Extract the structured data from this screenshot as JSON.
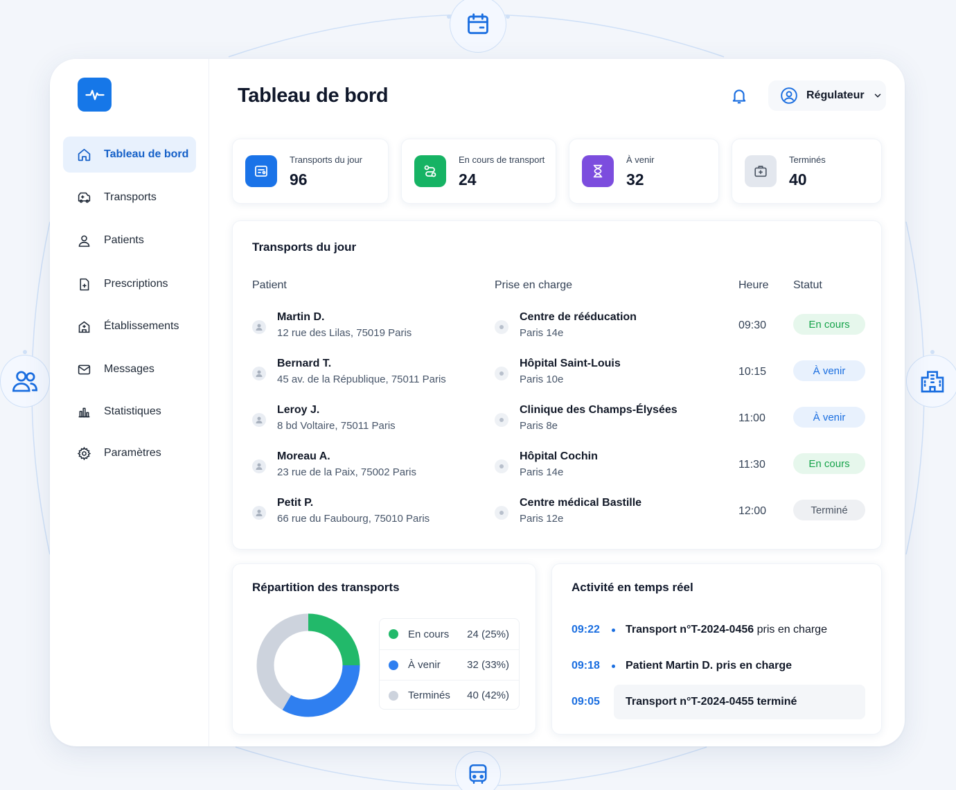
{
  "app": {
    "title": "Tableau de bord"
  },
  "sidebar": {
    "items": [
      {
        "label": "Tableau de bord",
        "icon": "home-icon",
        "active": true
      },
      {
        "label": "Transports",
        "icon": "ambulance-icon"
      },
      {
        "label": "Patients",
        "icon": "user-icon"
      },
      {
        "label": "Prescriptions",
        "icon": "document-icon"
      },
      {
        "label": "Établissements",
        "icon": "hospital-icon"
      },
      {
        "label": "Messages",
        "icon": "mail-icon"
      },
      {
        "label": "Statistiques",
        "icon": "chart-icon"
      },
      {
        "label": "Paramètres",
        "icon": "gear-icon"
      }
    ]
  },
  "header": {
    "title": "Tableau de bord",
    "user": "Régulateur"
  },
  "stats": [
    {
      "label": "Transports du jour",
      "value": "96",
      "color": "#1a73e8"
    },
    {
      "label": "En cours de transport",
      "value": "24",
      "color": "#16b364"
    },
    {
      "label": "À venir",
      "value": "32",
      "color": "#7c4dde"
    },
    {
      "label": "Terminés",
      "value": "40",
      "color": "#e3e7ee"
    }
  ],
  "transports": {
    "title": "Transports du jour",
    "columns": [
      "Patient",
      "Prise en charge",
      "Heure",
      "Statut"
    ],
    "rows": [
      {
        "name": "Martin D.",
        "address": "12 rue des Lilas, 75019 Paris",
        "place": "Centre de rééducation",
        "place_sub": "Paris 14e",
        "time": "09:30",
        "status": "En cours",
        "status_kind": "green"
      },
      {
        "name": "Bernard T.",
        "address": "45 av. de la République, 75011 Paris",
        "place": "Hôpital Saint-Louis",
        "place_sub": "Paris 10e",
        "time": "10:15",
        "status": "À venir",
        "status_kind": "blue"
      },
      {
        "name": "Leroy J.",
        "address": "8 bd Voltaire, 75011 Paris",
        "place": "Clinique des Champs-Élysées",
        "place_sub": "Paris 8e",
        "time": "11:00",
        "status": "À venir",
        "status_kind": "blue"
      },
      {
        "name": "Moreau A.",
        "address": "23 rue de la Paix, 75002 Paris",
        "place": "Hôpital Cochin",
        "place_sub": "Paris 14e",
        "time": "11:30",
        "status": "En cours",
        "status_kind": "green"
      },
      {
        "name": "Petit P.",
        "address": "66 rue du Faubourg, 75010 Paris",
        "place": "Centre médical Bastille",
        "place_sub": "Paris 12e",
        "time": "12:00",
        "status": "Terminé",
        "status_kind": "gray"
      }
    ]
  },
  "repartition": {
    "title": "Répartition des transports",
    "legend": [
      {
        "label": "En cours",
        "value": "24 (25%)",
        "color": "#22b96a"
      },
      {
        "label": "À venir",
        "value": "32 (33%)",
        "color": "#2f7ff0"
      },
      {
        "label": "Terminés",
        "value": "40 (42%)",
        "color": "#cdd3dd"
      }
    ]
  },
  "chart_data": {
    "type": "pie",
    "categories": [
      "En cours",
      "À venir",
      "Terminés"
    ],
    "values": [
      24,
      32,
      40
    ],
    "percent": [
      25,
      33,
      42
    ],
    "colors": [
      "#22b96a",
      "#2f7ff0",
      "#cdd3dd"
    ],
    "donut": true,
    "title": "Répartition des transports",
    "legend_placement": "right"
  },
  "activity": {
    "title": "Activité en temps réel",
    "items": [
      {
        "time": "09:22",
        "bold": "Transport n°T-2024-0456",
        "rest": " pris en charge"
      },
      {
        "time": "09:18",
        "bold": "Patient Martin D. pris en charge",
        "rest": ""
      },
      {
        "time": "09:05",
        "bold": "Transport n°T-2024-0455 terminé",
        "rest": ""
      }
    ]
  }
}
